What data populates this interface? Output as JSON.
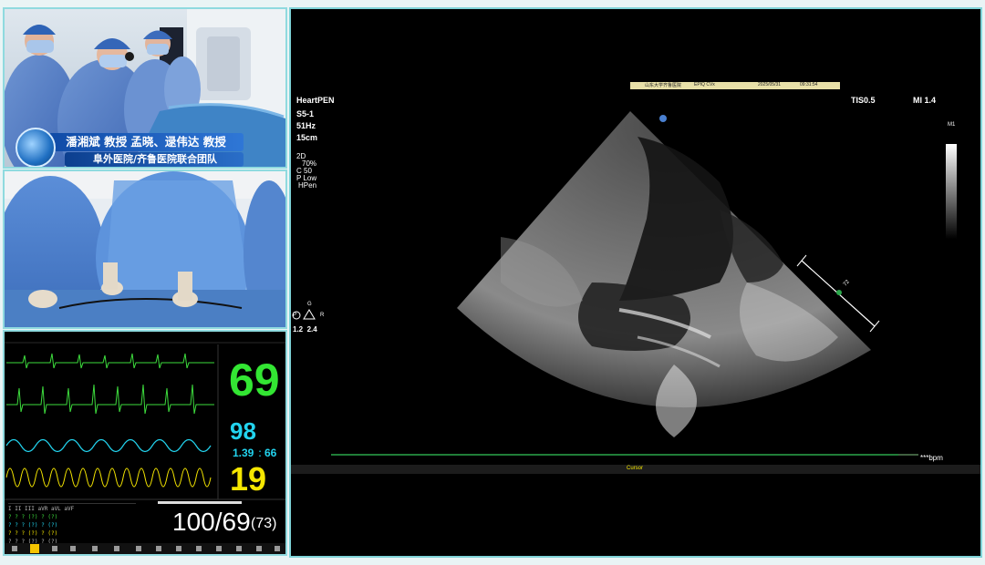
{
  "video_top": {
    "caption_line1": "潘湘斌 教授 孟晓、逯伟达 教授",
    "caption_line2": "阜外医院/齐鲁医院联合团队"
  },
  "monitor": {
    "heart_rate": "69",
    "spo2": "98",
    "pi": "1.39",
    "pr": "66",
    "resp": "19",
    "nibp": "100/69",
    "nibp_mean": "(73)"
  },
  "ultrasound": {
    "header_info": "山东大学齐鲁医院",
    "system": "EPIQ CVx",
    "date": "2025/05/31",
    "time": "09:31:54",
    "preset": "HeartPEN",
    "probe": "S5-1",
    "frame_rate": "51Hz",
    "depth": "15cm",
    "tis": "TIS0.5",
    "mi": "MI 1.4",
    "mode": "2D",
    "gain": "70%",
    "compress": "C 50",
    "power": "P Low",
    "harmonic": "HPen",
    "gray_map": "M1",
    "focus_g": "G",
    "focus_p": "P",
    "focus_r": "R",
    "focus_values": "1.2  2.4",
    "caliper_label": "72",
    "bpm": "***bpm",
    "cursor_label": "Cursor"
  },
  "colors": {
    "panel_border": "#8fdadf",
    "hr_green": "#33e633",
    "spo2_cyan": "#22d3ee",
    "resp_yellow": "#f5e600",
    "ecg_line": "#3ddc3d",
    "timeline": "#2aa84a"
  }
}
